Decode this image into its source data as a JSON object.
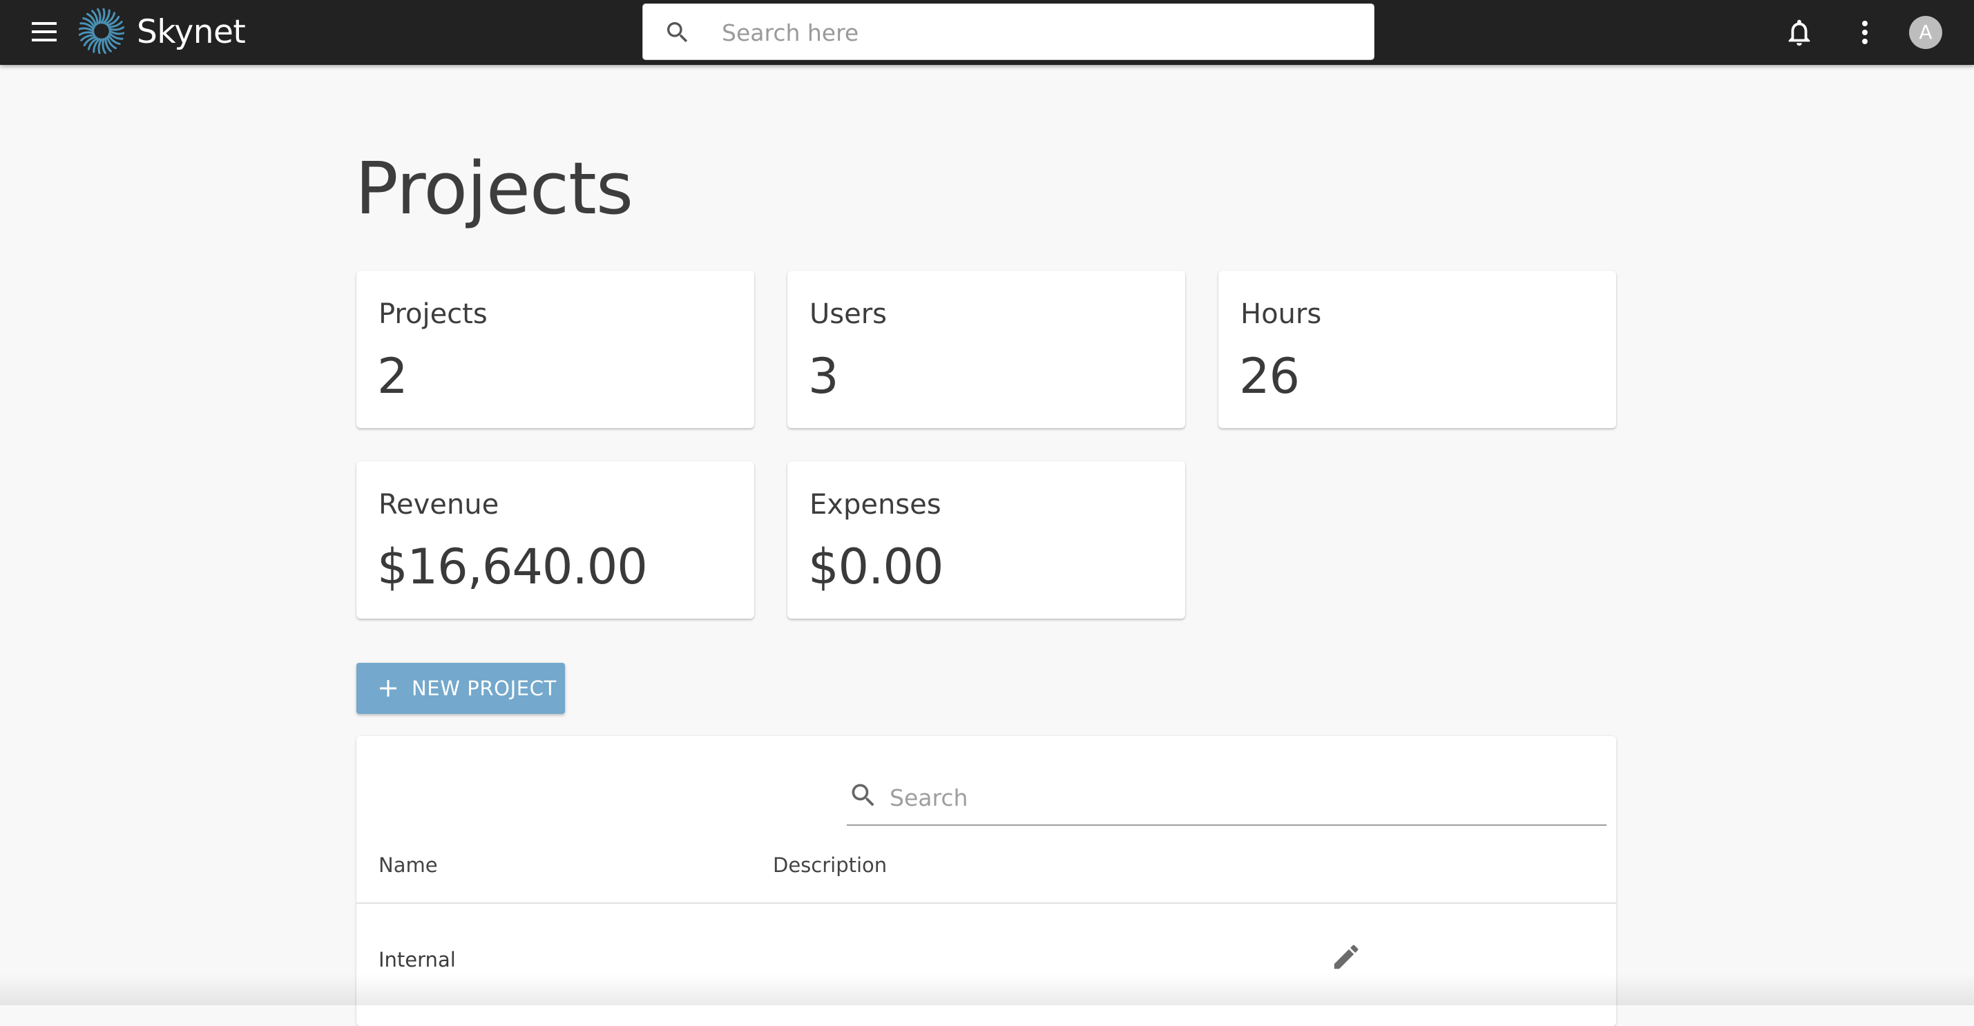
{
  "app": {
    "brand": "Skynet",
    "search_placeholder": "Search here",
    "avatar_initial": "A",
    "icons": [
      "menu-icon",
      "spiral-logo-icon",
      "search-icon",
      "bell-icon",
      "more-vert-icon"
    ]
  },
  "page": {
    "title": "Projects"
  },
  "stats": [
    {
      "label": "Projects",
      "value": "2"
    },
    {
      "label": "Users",
      "value": "3"
    },
    {
      "label": "Hours",
      "value": "26"
    },
    {
      "label": "Revenue",
      "value": "$16,640.00"
    },
    {
      "label": "Expenses",
      "value": "$0.00"
    }
  ],
  "actions": {
    "new_project_label": "NEW PROJECT"
  },
  "table": {
    "search_placeholder": "Search",
    "columns": [
      "Name",
      "Description"
    ],
    "rows": [
      {
        "name": "Internal",
        "description": ""
      }
    ]
  },
  "colors": {
    "topbar": "#222222",
    "primary_button": "#74a8cc",
    "background": "#f8f8f8",
    "logo": "#4a93b8"
  }
}
